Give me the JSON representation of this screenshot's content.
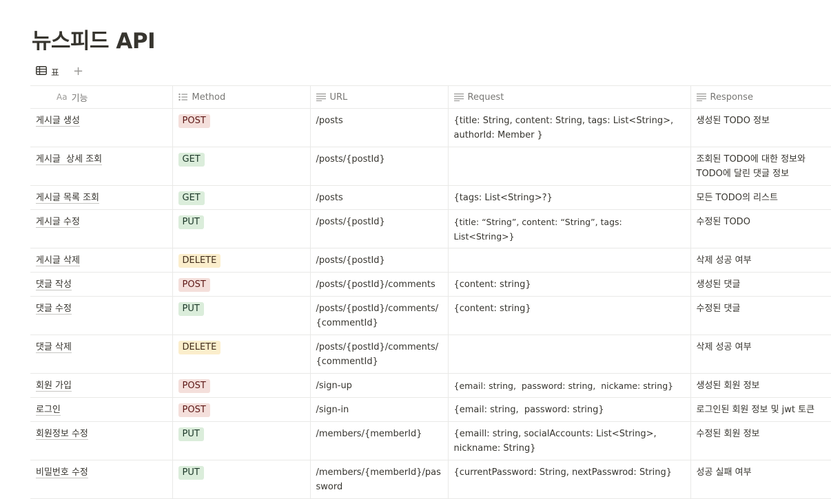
{
  "page": {
    "title": "뉴스피드 API"
  },
  "views": {
    "table_view_label": "표",
    "add_label": "+"
  },
  "columns": [
    {
      "icon": "Aa",
      "label": "기능"
    },
    {
      "icon": "list-icon",
      "label": "Method"
    },
    {
      "icon": "text-icon",
      "label": "URL"
    },
    {
      "icon": "text-icon",
      "label": "Request"
    },
    {
      "icon": "text-icon",
      "label": "Response"
    }
  ],
  "method_colors": {
    "POST": "#f4dfdb",
    "GET": "#dbeddb",
    "PUT": "#dbeddb",
    "DELETE": "#fbeecc"
  },
  "rows": [
    {
      "func": "게시글 생성",
      "method": "POST",
      "url": "/posts",
      "request": "{title: String, content: String, tags: List<String>, authorId: Member }",
      "response": "생성된 TODO 정보"
    },
    {
      "func": "게시글  상세 조회",
      "method": "GET",
      "url": "/posts/{postId}",
      "request": "",
      "response": "조회된 TODO에 대한 정보와 TODO에 달린 댓글 정보"
    },
    {
      "func": "게시글 목록 조회",
      "method": "GET",
      "url": "/posts",
      "request": "{tags: List<String>?}",
      "response": "모든 TODO의 리스트"
    },
    {
      "func": "게시글 수정",
      "method": "PUT",
      "url": "/posts/{postId}",
      "request": "{title: “String”, content: “String”, tags: List<String>}",
      "response": "수정된 TODO"
    },
    {
      "func": "게시글 삭제",
      "method": "DELETE",
      "url": "/posts/{postId}",
      "request": "",
      "response": "삭제 성공 여부"
    },
    {
      "func": "댓글 작성",
      "method": "POST",
      "url": "/posts/{postId}/comments",
      "request": "{content: string}",
      "response": "생성된 댓글"
    },
    {
      "func": "댓글 수정",
      "method": "PUT",
      "url": "/posts/{postId}/comments/{commentId}",
      "request": "{content: string}",
      "response": "수정된 댓글"
    },
    {
      "func": "댓글 삭제",
      "method": "DELETE",
      "url": "/posts/{postId}/comments/{commentId}",
      "request": "",
      "response": "삭제 성공 여부"
    },
    {
      "func": "회원 가입",
      "method": "POST",
      "url": "/sign-up",
      "request": "{email: string,  password: string,  nickame: string}",
      "response": "생성된 회원 정보"
    },
    {
      "func": "로그인",
      "method": "POST",
      "url": "/sign-in",
      "request": "{email: string,  password: string}",
      "response": "로그인된 회원 정보 및 jwt 토큰"
    },
    {
      "func": "회원정보 수정",
      "method": "PUT",
      "url": "/members/{memberId}",
      "request": "{emaill: string, socialAccounts: List<String>, nickname: String}",
      "response": "수정된 회원 정보"
    },
    {
      "func": "비밀번호 수정",
      "method": "PUT",
      "url": "/members/{memberId}/password",
      "request": "{currentPassword: String, nextPasswrod: String}",
      "response": "성공 실패 여부"
    }
  ]
}
